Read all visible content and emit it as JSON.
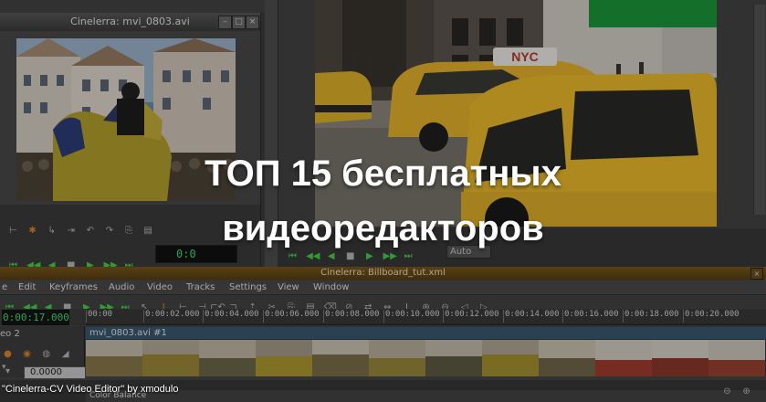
{
  "headline": {
    "line1": "ТОП 15 бесплатных",
    "line2": "видеоредакторов"
  },
  "caption": "\"Cinelerra-CV Video Editor\" by xmodulo",
  "viewer": {
    "title": "Cinelerra: mvi_0803.avi",
    "clock": "0:0"
  },
  "compositor": {
    "zoom_select": "Auto"
  },
  "main": {
    "title": "Cinelerra: Billboard_tut.xml",
    "menu": [
      "e",
      "Edit",
      "Keyframes",
      "Audio",
      "Video",
      "Tracks",
      "Settings",
      "View",
      "Window"
    ],
    "clock": "0:00:17.000",
    "ruler_ticks": [
      "00:00",
      "0:00:02.000",
      "0:00:04.000",
      "0:00:06.000",
      "0:00:08.000",
      "0:00:10.000",
      "0:00:12.000",
      "0:00:14.000",
      "0:00:16.000",
      "0:00:18.000",
      "0:00:20.000"
    ],
    "track_name": "eo 2",
    "asset_label": "mvi_0803.avi #1",
    "value_field": "0.0000",
    "color_balance": "Color Balance"
  },
  "colors": {
    "accent_title": "#6b4c1a",
    "clock_text": "#3ee07a",
    "transport_green": "#49d449"
  },
  "icons": [
    "rewind-icon",
    "play-reverse-icon",
    "stop-icon",
    "play-icon",
    "fast-forward-icon",
    "end-icon",
    "cursor-icon",
    "cut-icon",
    "copy-icon",
    "paste-icon",
    "close-icon"
  ]
}
